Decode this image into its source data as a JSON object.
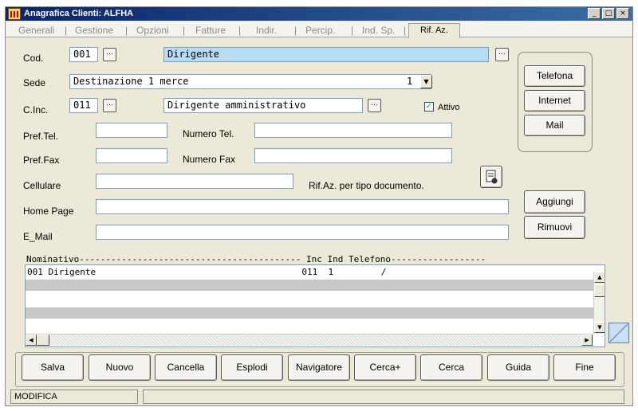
{
  "window": {
    "title": "Anagrafica Clienti: ALFHA"
  },
  "tabs": [
    {
      "label": "Generali"
    },
    {
      "label": "Gestione"
    },
    {
      "label": "Opzioni"
    },
    {
      "label": "Fatture"
    },
    {
      "label": "Indir."
    },
    {
      "label": "Percip."
    },
    {
      "label": "Ind. Sp."
    },
    {
      "label": "Rif. Az."
    }
  ],
  "form": {
    "cod_label": "Cod.",
    "cod_value": "001",
    "cod_desc": "Dirigente",
    "sede_label": "Sede",
    "sede_value": "Destinazione 1 merce",
    "sede_num": "1",
    "cinc_label": "C.Inc.",
    "cinc_value": "011",
    "cinc_desc": "Dirigente amministrativo",
    "attivo_label": "Attivo",
    "preftel_label": "Pref.Tel.",
    "numtel_label": "Numero Tel.",
    "preffax_label": "Pref.Fax",
    "numfax_label": "Numero Fax",
    "cellulare_label": "Cellulare",
    "rifaz_label": "Rif.Az. per tipo documento.",
    "homepage_label": "Home Page",
    "email_label": "E_Mail",
    "ellipsis": "..."
  },
  "side_buttons": {
    "telefona": "Telefona",
    "internet": "Internet",
    "mail": "Mail",
    "aggiungi": "Aggiungi",
    "rimuovi": "Rimuovi"
  },
  "list": {
    "header": "Nominativo------------------------------------------ Inc Ind Telefono------------------",
    "rows": [
      "001 Dirigente                                       011  1         /",
      "",
      "",
      "",
      ""
    ]
  },
  "footer_buttons": {
    "salva": "Salva",
    "nuovo": "Nuovo",
    "cancella": "Cancella",
    "esplodi": "Esplodi",
    "navigatore": "Navigatore",
    "cercaplus": "Cerca+",
    "cerca": "Cerca",
    "guida": "Guida",
    "fine": "Fine"
  },
  "status": {
    "mode": "MODIFICA",
    "message": ""
  },
  "colors": {
    "titlebar_start": "#0a246a",
    "titlebar_end": "#3a6ea5",
    "highlight_field": "#b9dcf5",
    "row_gray": "#c8c8c8"
  },
  "icons": [
    "app-icon",
    "ellipsis-icon",
    "dropdown-arrow-icon",
    "checkbox-checked-icon",
    "document-link-icon",
    "scroll-up-icon",
    "scroll-down-icon",
    "scroll-left-icon",
    "scroll-right-icon",
    "resize-grip-icon"
  ]
}
